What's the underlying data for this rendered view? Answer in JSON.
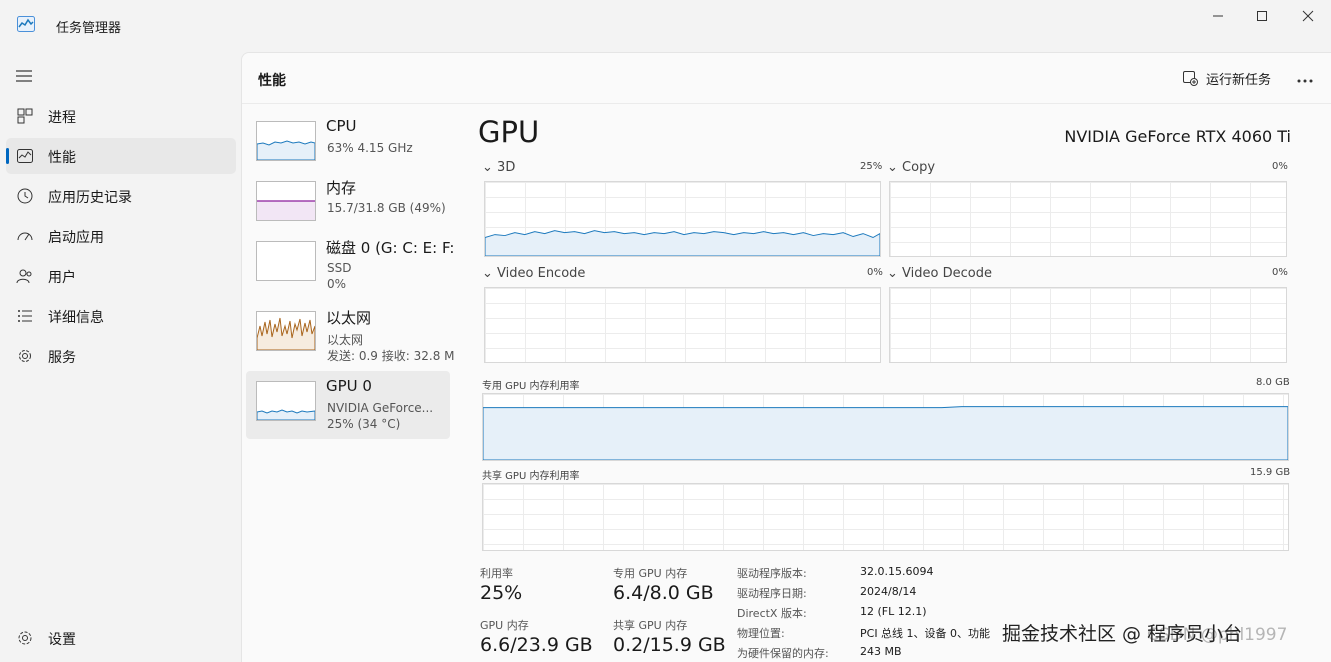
{
  "window": {
    "title": "任务管理器"
  },
  "nav": {
    "items": [
      {
        "label": "进程"
      },
      {
        "label": "性能"
      },
      {
        "label": "应用历史记录"
      },
      {
        "label": "启动应用"
      },
      {
        "label": "用户"
      },
      {
        "label": "详细信息"
      },
      {
        "label": "服务"
      }
    ],
    "settings": "设置",
    "active_index": 1
  },
  "header": {
    "title": "性能",
    "run_task": "运行新任务"
  },
  "devices": [
    {
      "name": "CPU",
      "line1": "63%  4.15 GHz",
      "line2": "",
      "color": "#1c79bd"
    },
    {
      "name": "内存",
      "line1": "15.7/31.8 GB (49%)",
      "line2": "",
      "color": "#8b1c9c"
    },
    {
      "name": "磁盘 0 (G: C: E: F:",
      "line1": "SSD",
      "line2": "0%",
      "color": "#2b8a2b"
    },
    {
      "name": "以太网",
      "line1": "以太网",
      "line2": "发送: 0.9  接收: 32.8 M",
      "color": "#a9651d"
    },
    {
      "name": "GPU 0",
      "line1": "NVIDIA GeForce...",
      "line2": "25% (34 °C)",
      "color": "#1c79bd"
    }
  ],
  "gpu": {
    "title": "GPU",
    "model": "NVIDIA GeForce RTX 4060 Ti",
    "engines": [
      {
        "name": "3D",
        "pct": "25%",
        "level": 0.25
      },
      {
        "name": "Copy",
        "pct": "0%",
        "level": 0
      },
      {
        "name": "Video Encode",
        "pct": "0%",
        "level": 0
      },
      {
        "name": "Video Decode",
        "pct": "0%",
        "level": 0
      }
    ],
    "dedicated": {
      "label": "专用 GPU 内存利用率",
      "max": "8.0 GB",
      "level": 0.8
    },
    "shared": {
      "label": "共享 GPU 内存利用率",
      "max": "15.9 GB",
      "level": 0.01
    },
    "stats": {
      "util_label": "利用率",
      "util_value": "25%",
      "ded_label": "专用 GPU 内存",
      "ded_value": "6.4/8.0 GB",
      "gpumem_label": "GPU 内存",
      "gpumem_value": "6.6/23.9 GB",
      "shared_label": "共享 GPU 内存",
      "shared_value": "0.2/15.9 GB"
    },
    "info": [
      {
        "key": "驱动程序版本:",
        "val": "32.0.15.6094"
      },
      {
        "key": "驱动程序日期:",
        "val": "2024/8/14"
      },
      {
        "key": "DirectX 版本:",
        "val": "12 (FL 12.1)"
      },
      {
        "key": "物理位置:",
        "val": "PCI 总线 1、设备 0、功能"
      },
      {
        "key": "为硬件保留的内存:",
        "val": "243 MB"
      }
    ]
  },
  "watermark": {
    "main": "掘金技术社区 @ 程序员小台",
    "sub": "CSDN @phl1997"
  }
}
